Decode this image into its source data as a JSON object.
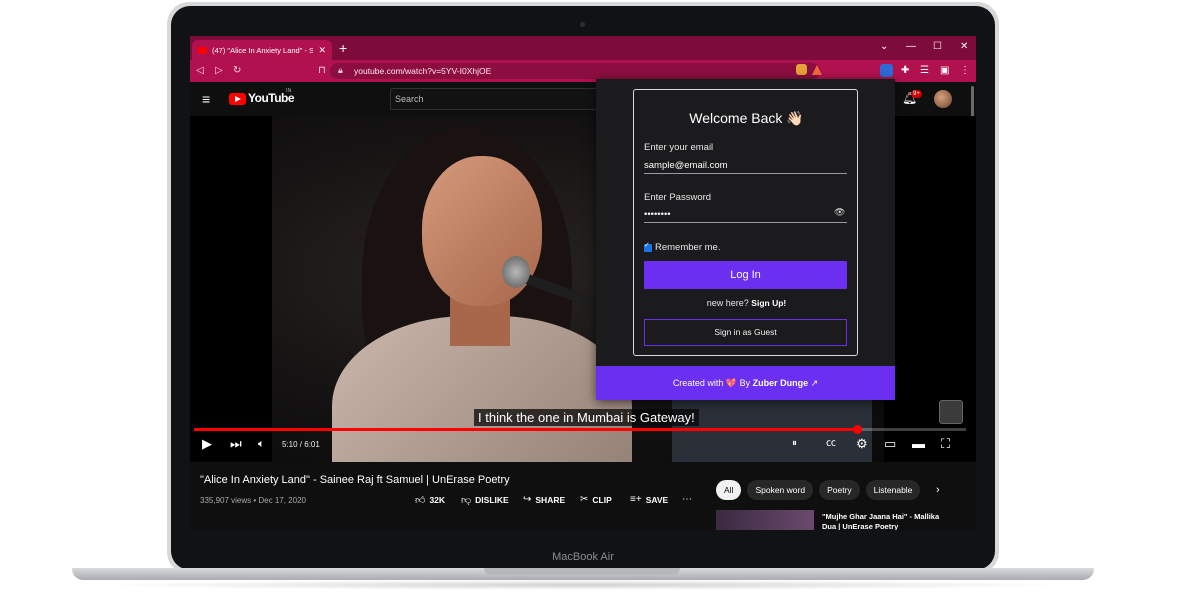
{
  "device": {
    "label": "MacBook Air"
  },
  "browser": {
    "tab_title": "(47) \"Alice In Anxiety Land\" - Sain",
    "url": "youtube.com/watch?v=5YV-I0XhjOE"
  },
  "youtube": {
    "wordmark": "YouTube",
    "country": "IN",
    "search_placeholder": "Search",
    "notification_count": "9+",
    "video": {
      "caption": "I think the one in Mumbai is Gateway!",
      "time": "5:10 / 6:01",
      "progress": 0.859,
      "title": "\"Alice In Anxiety Land\" - Sainee Raj ft Samuel | UnErase Poetry",
      "meta": "335,907 views • Dec 17, 2020"
    },
    "actions": {
      "likes": "32K",
      "dislike": "DISLIKE",
      "share": "SHARE",
      "clip": "CLIP",
      "save": "SAVE"
    },
    "chips": [
      "All",
      "Spoken word",
      "Poetry",
      "Listenable"
    ],
    "reco_title": "\"Mujhe Ghar Jaana Hai\" - Mallika Dua | UnErase Poetry"
  },
  "extension": {
    "welcome": "Welcome Back 👋🏻",
    "email_label": "Enter your email",
    "email_value": "sample@email.com",
    "password_label": "Enter Password",
    "password_value": "••••••••",
    "remember_label": "Remember me.",
    "login_label": "Log In",
    "new_here": "new here?",
    "signup": "Sign Up!",
    "guest_label": "Sign in as Guest",
    "footer_prefix": "Created with",
    "footer_heart": "💖",
    "footer_by": "By",
    "footer_author": "Zuber Dunge",
    "footer_link_icon": "↗",
    "colors": {
      "accent": "#6b2ff2",
      "panel": "#1b1b1d"
    }
  },
  "colors": {
    "chrome": "#b1124f",
    "tabstrip": "#7d0c3b",
    "yt_red": "#ff0000"
  }
}
